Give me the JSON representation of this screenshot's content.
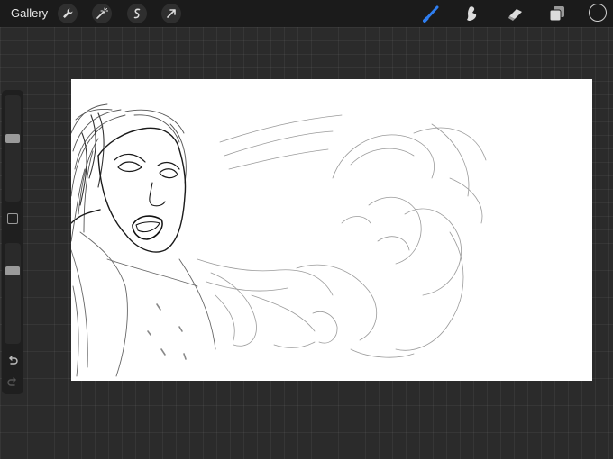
{
  "topbar": {
    "gallery_label": "Gallery",
    "left_tools": [
      "wrench-icon",
      "magic-wand-icon",
      "selection-icon",
      "transform-arrow-icon"
    ],
    "right_tools": [
      "brush-icon",
      "smudge-icon",
      "eraser-icon",
      "layers-icon"
    ],
    "active_tool": "brush",
    "accent_color": "#2f7ef0",
    "current_color": "#1b1b1b"
  },
  "sidebar": {
    "brush_size_level": 0.6,
    "opacity_level": 0.75
  },
  "canvas": {
    "background": "#ffffff"
  }
}
